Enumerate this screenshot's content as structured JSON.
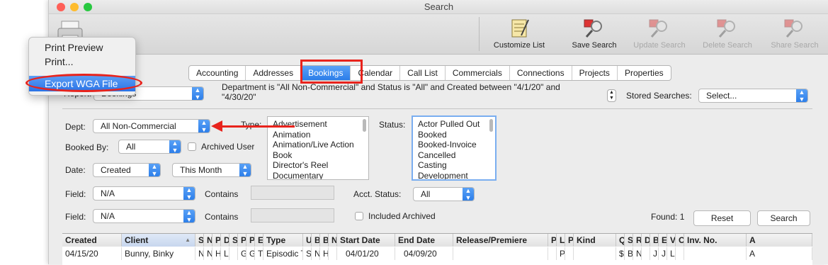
{
  "window": {
    "title": "Search"
  },
  "colors": {
    "accent": "#2b7de9",
    "highlight": "#e8231c",
    "traffic_red": "#fe5f57",
    "traffic_yellow": "#febc2e",
    "traffic_green": "#28c840"
  },
  "toolbar": {
    "customize_list": "Customize List",
    "save_search": "Save Search",
    "update_search": "Update Search",
    "delete_search": "Delete Search",
    "share_search": "Share Search"
  },
  "print_menu": {
    "items": [
      "Print Preview",
      "Print...",
      "Export WGA File"
    ],
    "selected": "Export WGA File"
  },
  "tabs": [
    "Accounting",
    "Addresses",
    "Bookings",
    "Calendar",
    "Call List",
    "Commercials",
    "Connections",
    "Projects",
    "Properties"
  ],
  "active_tab": "Bookings",
  "report": {
    "label": "Report:",
    "value": "Bookings"
  },
  "criteria_text": "Department is \"All Non-Commercial\" and Status is \"All\" and Created between \"4/1/20\" and \"4/30/20\"",
  "stored_searches": {
    "label": "Stored Searches:",
    "value": "Select..."
  },
  "filters": {
    "dept_label": "Dept:",
    "dept_value": "All Non-Commercial",
    "type_label": "Type:",
    "type_options": [
      "Advertisement",
      "Animation",
      "Animation/Live Action",
      "Book",
      "Director's Reel",
      "Documentary"
    ],
    "status_label": "Status:",
    "status_options": [
      "Actor Pulled Out",
      "Booked",
      "Booked-Invoice",
      "Cancelled",
      "Casting",
      "Development"
    ],
    "booked_by_label": "Booked By:",
    "booked_by_value": "All",
    "archived_users_label": "Archived Users",
    "date_label": "Date:",
    "date_field": "Created",
    "date_range": "This Month",
    "field1_label": "Field:",
    "field1_value": "N/A",
    "contains1_label": "Contains",
    "field2_label": "Field:",
    "field2_value": "N/A",
    "contains2_label": "Contains",
    "acct_status_label": "Acct. Status:",
    "acct_status_value": "All",
    "included_archived_label": "Included Archived",
    "found": "Found: 1",
    "reset": "Reset",
    "search": "Search"
  },
  "grid": {
    "headers": [
      "Created",
      "Client",
      "S",
      "N",
      "P",
      "D",
      "S",
      "P",
      "P",
      "E",
      "Type",
      "U",
      "B",
      "B",
      "N",
      "Start Date",
      "End Date",
      "Release/Premiere",
      "P",
      "L",
      "P",
      "Kind",
      "Q",
      "S",
      "R",
      "D",
      "B",
      "E",
      "V",
      "C",
      "Inv. No.",
      "A"
    ],
    "rows": [
      [
        "04/15/20",
        "Bunny, Binky",
        "N",
        "N",
        "H",
        "L",
        "",
        "G",
        "G",
        "T",
        "Episodic TV",
        "S",
        "N",
        "H",
        "",
        "04/01/20",
        "04/09/20",
        "",
        "",
        "P",
        "",
        "",
        "$",
        "B",
        "N",
        "",
        "J",
        "J",
        "L",
        "",
        "",
        "A"
      ]
    ]
  }
}
